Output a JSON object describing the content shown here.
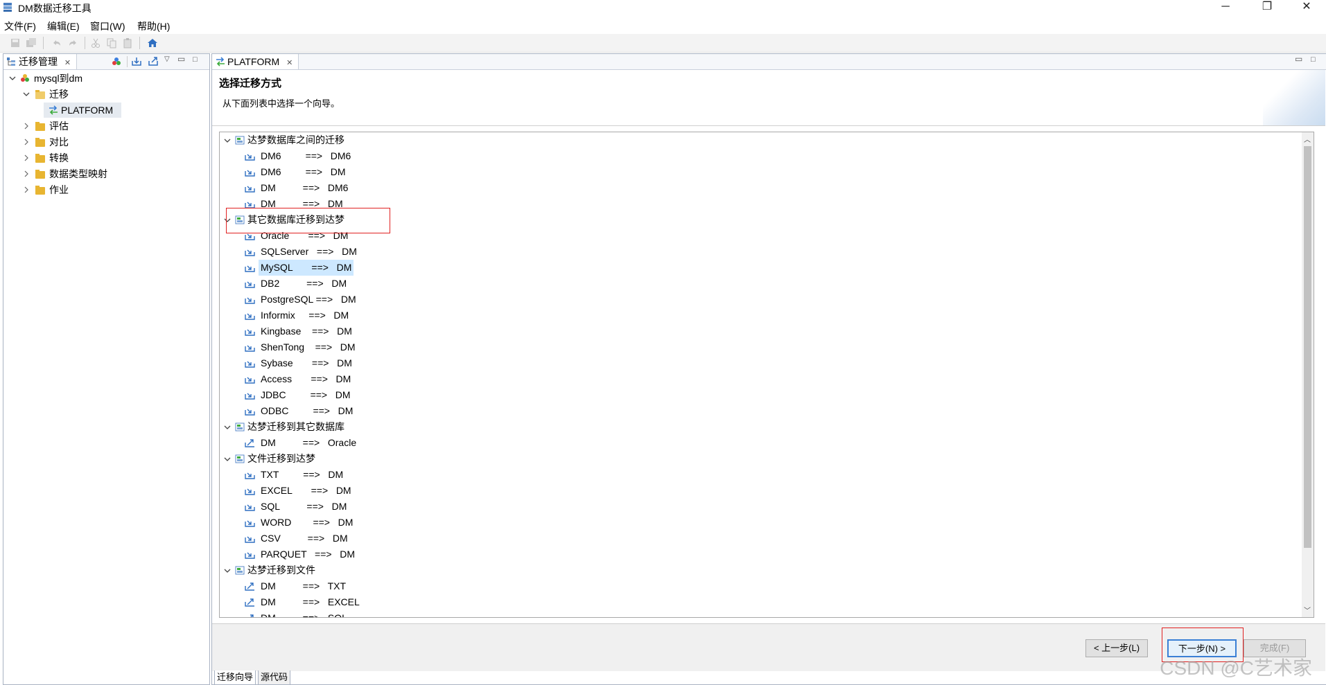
{
  "window": {
    "title": "DM数据迁移工具",
    "controls": [
      "─",
      "❐",
      "✕"
    ]
  },
  "menu": [
    "文件(F)",
    "编辑(E)",
    "窗口(W)",
    "帮助(H)"
  ],
  "left_panel": {
    "tab_label": "迁移管理",
    "tree": [
      {
        "label": "mysql到dm",
        "expanded": true
      },
      {
        "label": "迁移",
        "expanded": true
      },
      {
        "label": "PLATFORM"
      },
      {
        "label": "评估"
      },
      {
        "label": "对比"
      },
      {
        "label": "转换"
      },
      {
        "label": "数据类型映射"
      },
      {
        "label": "作业"
      }
    ]
  },
  "editor": {
    "tab_label": "PLATFORM",
    "header_title": "选择迁移方式",
    "header_subtitle": "从下面列表中选择一个向导。",
    "groups": [
      {
        "label": "达梦数据库之间的迁移",
        "items": [
          "DM6         ==>   DM6",
          "DM6         ==>   DM",
          "DM          ==>   DM6",
          "DM          ==>   DM"
        ]
      },
      {
        "label": "其它数据库迁移到达梦",
        "items": [
          "Oracle       ==>   DM",
          "SQLServer   ==>   DM",
          "MySQL       ==>   DM",
          "DB2          ==>   DM",
          "PostgreSQL ==>   DM",
          "Informix     ==>   DM",
          "Kingbase    ==>   DM",
          "ShenTong    ==>   DM",
          "Sybase       ==>   DM",
          "Access       ==>   DM",
          "JDBC         ==>   DM",
          "ODBC         ==>   DM"
        ]
      },
      {
        "label": "达梦迁移到其它数据库",
        "items": [
          "DM          ==>   Oracle"
        ]
      },
      {
        "label": "文件迁移到达梦",
        "items": [
          "TXT         ==>   DM",
          "EXCEL       ==>   DM",
          "SQL          ==>   DM",
          "WORD        ==>   DM",
          "CSV          ==>   DM",
          "PARQUET   ==>   DM"
        ]
      },
      {
        "label": "达梦迁移到文件",
        "items": [
          "DM          ==>   TXT",
          "DM          ==>   EXCEL",
          "DM          ==>   SQL"
        ]
      }
    ],
    "selected_item": "MySQL       ==>   DM",
    "buttons": {
      "back": "< 上一步(L)",
      "next": "下一步(N) >",
      "finish": "完成(F)"
    },
    "bottom_tabs": [
      "迁移向导",
      "源代码"
    ]
  },
  "watermark": "CSDN @C艺术家",
  "colors": {
    "selection": "#cde8ff",
    "highlight_box": "#e02020",
    "folder": "#e8b531"
  }
}
